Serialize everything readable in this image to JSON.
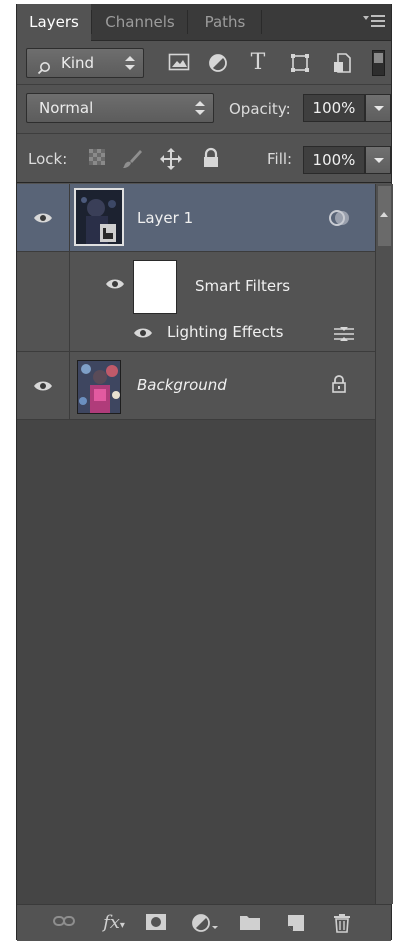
{
  "tabs": [
    {
      "label": "Layers",
      "active": true
    },
    {
      "label": "Channels",
      "active": false
    },
    {
      "label": "Paths",
      "active": false
    }
  ],
  "filter": {
    "kind_label": "Kind",
    "icons": [
      "image-filter-icon",
      "adjustment-filter-icon",
      "type-filter-icon",
      "shape-filter-icon",
      "smart-object-filter-icon",
      "filter-toggle-icon"
    ]
  },
  "blend": {
    "mode": "Normal",
    "opacity_label": "Opacity:",
    "opacity_value": "100%"
  },
  "lock": {
    "label": "Lock:",
    "fill_label": "Fill:",
    "fill_value": "100%",
    "icons": [
      "lock-transparent-icon",
      "lock-image-icon",
      "lock-position-icon",
      "lock-all-icon"
    ]
  },
  "layers": [
    {
      "name": "Layer 1",
      "selected": true,
      "visible": true
    },
    {
      "name": "Smart Filters",
      "visible": true
    },
    {
      "name": "Lighting Effects",
      "visible": true
    },
    {
      "name": "Background",
      "visible": true,
      "locked": true
    }
  ],
  "bottom_icons": [
    "link-icon",
    "fx-icon",
    "mask-icon",
    "adjustment-icon",
    "folder-icon",
    "new-layer-icon",
    "trash-icon"
  ],
  "colors": {
    "panel": "#535353",
    "selected_row": "#596477",
    "list_bg": "#454545"
  }
}
